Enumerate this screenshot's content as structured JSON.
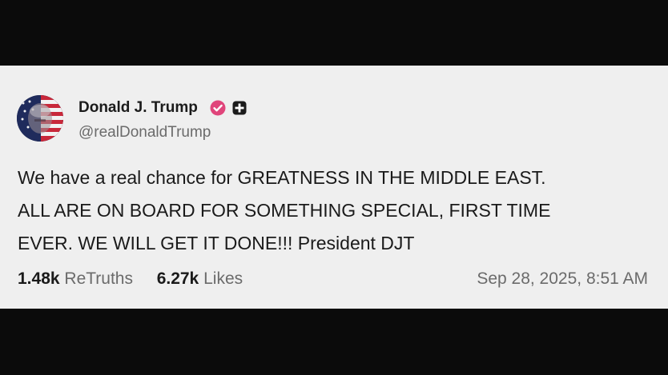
{
  "post": {
    "author_name": "Donald J. Trump",
    "handle": "@realDonaldTrump",
    "avatar_icon": "user-avatar-flag",
    "verified_icon": "verified-badge-icon",
    "plus_icon": "plus-badge-icon",
    "body_lines": [
      "We have a real chance for GREATNESS IN THE MIDDLE EAST.",
      "ALL ARE ON BOARD FOR SOMETHING SPECIAL, FIRST TIME",
      "EVER. WE WILL GET IT DONE!!! President DJT"
    ],
    "retruths_count": "1.48k",
    "retruths_label": "ReTruths",
    "likes_count": "6.27k",
    "likes_label": "Likes",
    "timestamp": "Sep 28, 2025, 8:51 AM"
  },
  "colors": {
    "card_background": "#efefef",
    "letterbox": "#0b0b0b",
    "verified_badge": "#e0457b",
    "secondary_text": "#6b6b6b",
    "primary_text": "#1a1a1a"
  }
}
